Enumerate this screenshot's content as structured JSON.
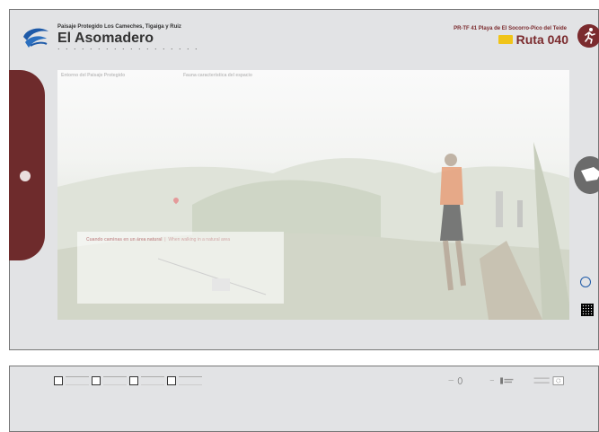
{
  "header": {
    "subtitle": "Paisaje Protegido Los Cameches, Tigaiga y Ruiz",
    "title": "El Asomadero",
    "route_label": "PR-TF 41 Playa de El Socorro-Pico del Teide",
    "ruta": "Ruta 040"
  },
  "photo_text": {
    "left_heading": "Entorno del Paisaje Protegido",
    "right_heading": "Fauna característica del espacio"
  },
  "sign": {
    "heading_es": "Cuando caminas en un área natural",
    "heading_en": "When walking in a natural area"
  },
  "colors": {
    "brand": "#7b2b2e",
    "panel": "#e2e3e5",
    "accent_yellow": "#f0c419"
  },
  "icons": {
    "logo": "park-logo-icon",
    "runner": "runner-icon",
    "accessibility": "wheelchair-icon",
    "qr": "qr-code-icon"
  }
}
